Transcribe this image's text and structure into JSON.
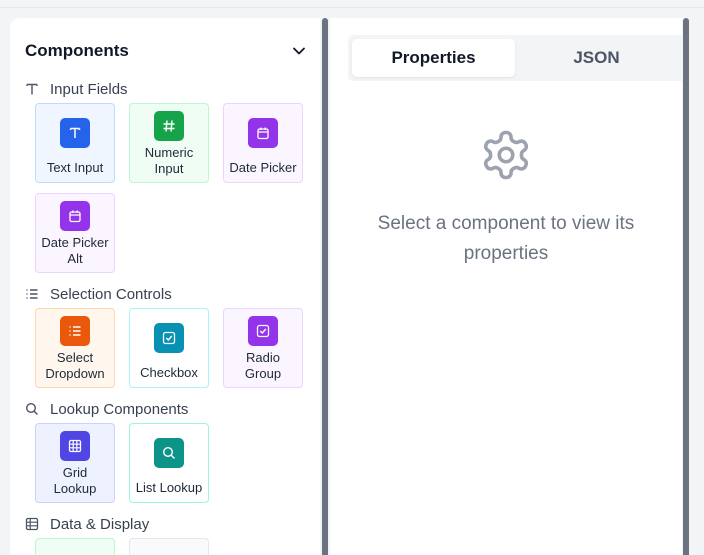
{
  "components_panel": {
    "title": "Components",
    "sections": [
      {
        "label": "Input Fields",
        "icon": "type-icon",
        "items": [
          {
            "label": "Text Input",
            "icon": "text-t-icon",
            "color": "#2563eb"
          },
          {
            "label": "Numeric Input",
            "icon": "hash-icon",
            "color": "#16a34a"
          },
          {
            "label": "Date Picker",
            "icon": "calendar-icon",
            "color": "#9333ea"
          },
          {
            "label": "Date Picker Alt",
            "icon": "calendar-icon",
            "color": "#9333ea"
          }
        ]
      },
      {
        "label": "Selection Controls",
        "icon": "list-icon",
        "items": [
          {
            "label": "Select Dropdown",
            "icon": "list-icon",
            "color": "#ea580c"
          },
          {
            "label": "Checkbox",
            "icon": "check-square-icon",
            "color": "#0891b2"
          },
          {
            "label": "Radio Group",
            "icon": "check-square-icon",
            "color": "#9333ea"
          }
        ]
      },
      {
        "label": "Lookup Components",
        "icon": "search-icon",
        "items": [
          {
            "label": "Grid Lookup",
            "icon": "grid-icon",
            "color": "#4f46e5"
          },
          {
            "label": "List Lookup",
            "icon": "search-icon",
            "color": "#0d9488"
          }
        ]
      },
      {
        "label": "Data & Display",
        "icon": "table-icon",
        "items": []
      }
    ]
  },
  "properties_panel": {
    "tabs": [
      {
        "label": "Properties",
        "active": true
      },
      {
        "label": "JSON",
        "active": false
      }
    ],
    "empty_message": "Select a component to view its properties",
    "empty_icon": "gear-icon"
  }
}
